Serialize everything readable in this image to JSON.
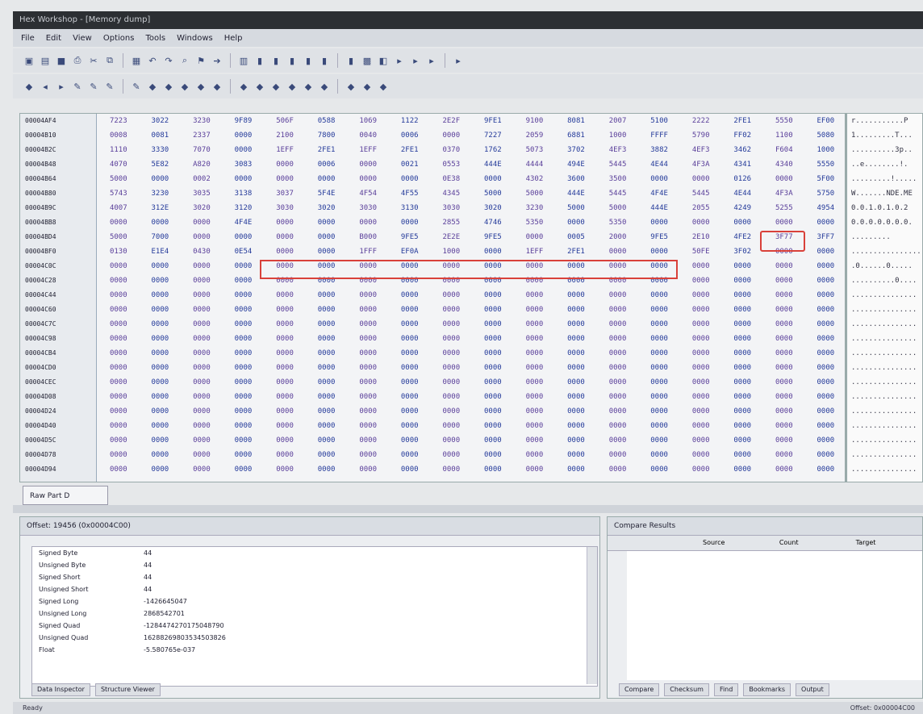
{
  "window": {
    "title": "Hex Workshop - [Memory dump]"
  },
  "menu": [
    "File",
    "Edit",
    "View",
    "Options",
    "Tools",
    "Windows",
    "Help"
  ],
  "toolbar1": [
    "save-icon",
    "open-icon",
    "disk-icon",
    "print-icon",
    "cut-icon",
    "copy-icon",
    "paste-icon",
    "undo-icon",
    "redo-icon",
    "find-icon",
    "bookmark-icon",
    "goto-icon",
    "view-icon",
    "bit-icon",
    "bit-icon",
    "bit-icon",
    "bit-icon",
    "bit-icon",
    "bit-icon",
    "calc-icon",
    "compare-icon",
    "nav-icon",
    "nav-icon",
    "nav-icon",
    "nav-icon"
  ],
  "toolbar2": [
    "tool-icon",
    "prev-icon",
    "next-icon",
    "mark-icon",
    "mark-icon",
    "mark-icon",
    "mark-icon",
    "tool-icon",
    "tool-icon",
    "tool-icon",
    "tool-icon",
    "tool-icon",
    "tool-icon",
    "tool-icon",
    "tool-icon",
    "tool-icon",
    "tool-icon",
    "tool-icon",
    "tool-icon",
    "tool-icon",
    "tool-icon"
  ],
  "offsets": [
    "00004AF4",
    "00004B10",
    "00004B2C",
    "00004B48",
    "00004B64",
    "00004B80",
    "00004B9C",
    "00004BB8",
    "00004BD4",
    "00004BF0",
    "00004C0C",
    "00004C28",
    "00004C44",
    "00004C60",
    "00004C7C",
    "00004C98",
    "00004CB4",
    "00004CD0",
    "00004CEC",
    "00004D08",
    "00004D24",
    "00004D40",
    "00004D5C",
    "00004D78",
    "00004D94"
  ],
  "hexrows": [
    [
      "7223",
      "3022",
      "3230",
      "9F89",
      "506F",
      "0588",
      "1069",
      "1122",
      "2E2F",
      "9FE1",
      "9100",
      "8081",
      "2007",
      "5100",
      "2222",
      "2FE1",
      "5550",
      "EF00"
    ],
    [
      "0008",
      "0081",
      "2337",
      "0000",
      "2100",
      "7800",
      "0040",
      "0006",
      "0000",
      "7227",
      "2059",
      "6881",
      "1000",
      "FFFF",
      "5790",
      "FF02",
      "1100",
      "5080"
    ],
    [
      "1110",
      "3330",
      "7070",
      "0000",
      "1EFF",
      "2FE1",
      "1EFF",
      "2FE1",
      "0370",
      "1762",
      "5073",
      "3702",
      "4EF3",
      "3882",
      "4EF3",
      "3462",
      "F604",
      "1000"
    ],
    [
      "4070",
      "5E82",
      "A820",
      "3083",
      "0000",
      "0006",
      "0000",
      "0021",
      "0553",
      "444E",
      "4444",
      "494E",
      "5445",
      "4E44",
      "4F3A",
      "4341",
      "4340",
      "5550"
    ],
    [
      "5000",
      "0000",
      "0002",
      "0000",
      "0000",
      "0000",
      "0000",
      "0000",
      "0E38",
      "0000",
      "4302",
      "3600",
      "3500",
      "0000",
      "0000",
      "0126",
      "0000",
      "5F00"
    ],
    [
      "5743",
      "3230",
      "3035",
      "3138",
      "3037",
      "5F4E",
      "4F54",
      "4F55",
      "4345",
      "5000",
      "5000",
      "444E",
      "5445",
      "4F4E",
      "5445",
      "4E44",
      "4F3A",
      "5750"
    ],
    [
      "4007",
      "312E",
      "3020",
      "3120",
      "3030",
      "3020",
      "3030",
      "3130",
      "3030",
      "3020",
      "3230",
      "5000",
      "5000",
      "444E",
      "2055",
      "4249",
      "5255",
      "4954"
    ],
    [
      "0000",
      "0000",
      "0000",
      "4F4E",
      "0000",
      "0000",
      "0000",
      "0000",
      "2855",
      "4746",
      "5350",
      "0000",
      "5350",
      "0000",
      "0000",
      "0000",
      "0000",
      "0000"
    ],
    [
      "5000",
      "7000",
      "0000",
      "0000",
      "0000",
      "0000",
      "B000",
      "9FE5",
      "2E2E",
      "9FE5",
      "0000",
      "0005",
      "2000",
      "9FE5",
      "2E10",
      "4FE2",
      "3F77",
      "3FF7"
    ],
    [
      "0130",
      "E1E4",
      "0430",
      "0E54",
      "0000",
      "0000",
      "1FFF",
      "EF0A",
      "1000",
      "0000",
      "1EFF",
      "2FE1",
      "0000",
      "0000",
      "50FE",
      "3F02",
      "0000",
      "0000"
    ],
    [
      "0000",
      "0000",
      "0000",
      "0000",
      "0000",
      "0000",
      "0000",
      "0000",
      "0000",
      "0000",
      "0000",
      "0000",
      "0000",
      "0000",
      "0000",
      "0000",
      "0000",
      "0000"
    ],
    [
      "0000",
      "0000",
      "0000",
      "0000",
      "0000",
      "0000",
      "0000",
      "0000",
      "0000",
      "0000",
      "0000",
      "0000",
      "0000",
      "0000",
      "0000",
      "0000",
      "0000",
      "0000"
    ],
    [
      "0000",
      "0000",
      "0000",
      "0000",
      "0000",
      "0000",
      "0000",
      "0000",
      "0000",
      "0000",
      "0000",
      "0000",
      "0000",
      "0000",
      "0000",
      "0000",
      "0000",
      "0000"
    ],
    [
      "0000",
      "0000",
      "0000",
      "0000",
      "0000",
      "0000",
      "0000",
      "0000",
      "0000",
      "0000",
      "0000",
      "0000",
      "0000",
      "0000",
      "0000",
      "0000",
      "0000",
      "0000"
    ],
    [
      "0000",
      "0000",
      "0000",
      "0000",
      "0000",
      "0000",
      "0000",
      "0000",
      "0000",
      "0000",
      "0000",
      "0000",
      "0000",
      "0000",
      "0000",
      "0000",
      "0000",
      "0000"
    ],
    [
      "0000",
      "0000",
      "0000",
      "0000",
      "0000",
      "0000",
      "0000",
      "0000",
      "0000",
      "0000",
      "0000",
      "0000",
      "0000",
      "0000",
      "0000",
      "0000",
      "0000",
      "0000"
    ],
    [
      "0000",
      "0000",
      "0000",
      "0000",
      "0000",
      "0000",
      "0000",
      "0000",
      "0000",
      "0000",
      "0000",
      "0000",
      "0000",
      "0000",
      "0000",
      "0000",
      "0000",
      "0000"
    ],
    [
      "0000",
      "0000",
      "0000",
      "0000",
      "0000",
      "0000",
      "0000",
      "0000",
      "0000",
      "0000",
      "0000",
      "0000",
      "0000",
      "0000",
      "0000",
      "0000",
      "0000",
      "0000"
    ],
    [
      "0000",
      "0000",
      "0000",
      "0000",
      "0000",
      "0000",
      "0000",
      "0000",
      "0000",
      "0000",
      "0000",
      "0000",
      "0000",
      "0000",
      "0000",
      "0000",
      "0000",
      "0000"
    ],
    [
      "0000",
      "0000",
      "0000",
      "0000",
      "0000",
      "0000",
      "0000",
      "0000",
      "0000",
      "0000",
      "0000",
      "0000",
      "0000",
      "0000",
      "0000",
      "0000",
      "0000",
      "0000"
    ],
    [
      "0000",
      "0000",
      "0000",
      "0000",
      "0000",
      "0000",
      "0000",
      "0000",
      "0000",
      "0000",
      "0000",
      "0000",
      "0000",
      "0000",
      "0000",
      "0000",
      "0000",
      "0000"
    ],
    [
      "0000",
      "0000",
      "0000",
      "0000",
      "0000",
      "0000",
      "0000",
      "0000",
      "0000",
      "0000",
      "0000",
      "0000",
      "0000",
      "0000",
      "0000",
      "0000",
      "0000",
      "0000"
    ],
    [
      "0000",
      "0000",
      "0000",
      "0000",
      "0000",
      "0000",
      "0000",
      "0000",
      "0000",
      "0000",
      "0000",
      "0000",
      "0000",
      "0000",
      "0000",
      "0000",
      "0000",
      "0000"
    ],
    [
      "0000",
      "0000",
      "0000",
      "0000",
      "0000",
      "0000",
      "0000",
      "0000",
      "0000",
      "0000",
      "0000",
      "0000",
      "0000",
      "0000",
      "0000",
      "0000",
      "0000",
      "0000"
    ],
    [
      "0000",
      "0000",
      "0000",
      "0000",
      "0000",
      "0000",
      "0000",
      "0000",
      "0000",
      "0000",
      "0000",
      "0000",
      "0000",
      "0000",
      "0000",
      "0000",
      "0000",
      "0000"
    ]
  ],
  "ascii": [
    "r...........P",
    "1.........T...",
    "..........3p..",
    "..e........!.",
    ".........!.....",
    "W.......NDE.ME",
    "0.0.1.0.1.0.2",
    "0.0.0.0.0.0.0.",
    ".........",
    "...................",
    ".0......0.....",
    "..........0....",
    "...............",
    "...............",
    "...............",
    "...............",
    "...............",
    "...............",
    "...............",
    "...............",
    "...............",
    "...............",
    "...............",
    "...............",
    "..............."
  ],
  "file_tab": "Raw Part D",
  "inspector": {
    "header": "Offset: 19456 (0x00004C00)",
    "rows": [
      {
        "label": "Signed Byte",
        "value": "44"
      },
      {
        "label": "Unsigned Byte",
        "value": "44"
      },
      {
        "label": "Signed Short",
        "value": "44"
      },
      {
        "label": "Unsigned Short",
        "value": "44"
      },
      {
        "label": "Signed Long",
        "value": "-1426645047"
      },
      {
        "label": "Unsigned Long",
        "value": "2868542701"
      },
      {
        "label": "Signed Quad",
        "value": "-1284474270175048790"
      },
      {
        "label": "Unsigned Quad",
        "value": "16288269803534503826"
      },
      {
        "label": "Float",
        "value": "-5.580765e-037"
      }
    ],
    "tabs": [
      "Data Inspector",
      "Structure Viewer"
    ]
  },
  "compare": {
    "header": "Compare Results",
    "columns": [
      "Source",
      "Count",
      "Target"
    ],
    "tabs": [
      "Compare",
      "Checksum",
      "Find",
      "Bookmarks",
      "Output"
    ]
  },
  "status": {
    "left": "Ready",
    "right": "Offset: 0x00004C00"
  }
}
